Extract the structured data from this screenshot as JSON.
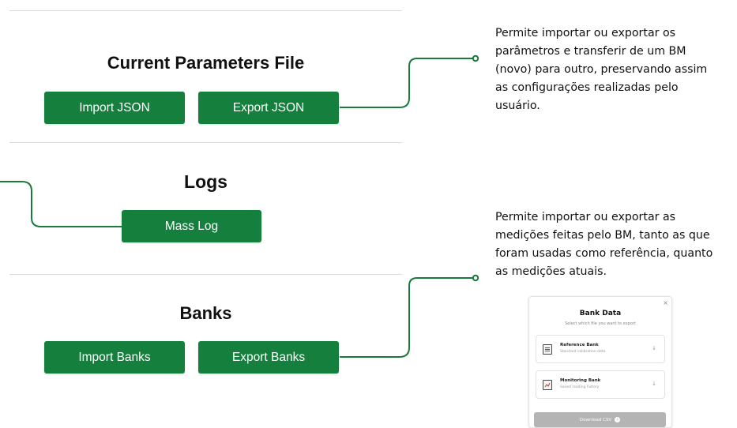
{
  "parameters_section": {
    "title": "Current Parameters File",
    "import_label": "Import JSON",
    "export_label": "Export JSON"
  },
  "logs_section": {
    "title": "Logs",
    "mass_log_label": "Mass Log"
  },
  "banks_section": {
    "title": "Banks",
    "import_label": "Import Banks",
    "export_label": "Export Banks"
  },
  "annotations": {
    "parameters_note": "Permite importar ou exportar os parâmetros e transferir de um BM (novo) para outro, preservando assim as configurações realizadas pelo usuário.",
    "banks_note": "Permite importar ou exportar as medições feitas pelo BM, tanto as que foram usadas como referência, quanto as medições atuais."
  },
  "bank_data_modal": {
    "title": "Bank Data",
    "subtitle": "Select which file you want to export",
    "close_glyph": "×",
    "options": [
      {
        "name": "Reference Bank",
        "description": "Standard calibration data",
        "arrow": "↓"
      },
      {
        "name": "Monitoring Bank",
        "description": "Saved reading history",
        "arrow": "↓"
      }
    ],
    "download_label": "Download CSV",
    "download_icon": "↓"
  },
  "colors": {
    "accent_green": "#15803d",
    "connector_green": "#1a7a3c",
    "divider": "#dcdcdc",
    "disabled_button": "#b4b4b4"
  }
}
